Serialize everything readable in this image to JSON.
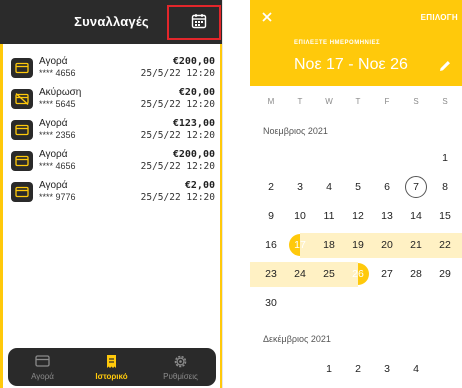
{
  "left": {
    "title": "Συναλλαγές",
    "transactions": [
      {
        "type": "Αγορά",
        "card": "**** 4656",
        "amount": "€200,00",
        "date": "25/5/22 12:20",
        "icon": "card-icon"
      },
      {
        "type": "Ακύρωση",
        "card": "**** 5645",
        "amount": "€20,00",
        "date": "25/5/22 12:20",
        "icon": "card-cancelled-icon"
      },
      {
        "type": "Αγορά",
        "card": "**** 2356",
        "amount": "€123,00",
        "date": "25/5/22 12:20",
        "icon": "card-icon"
      },
      {
        "type": "Αγορά",
        "card": "**** 4656",
        "amount": "€200,00",
        "date": "25/5/22 12:20",
        "icon": "card-icon"
      },
      {
        "type": "Αγορά",
        "card": "**** 9776",
        "amount": "€2,00",
        "date": "25/5/22 12:20",
        "icon": "card-icon"
      }
    ],
    "nav": [
      {
        "label": "Αγορά",
        "icon": "card-icon",
        "active": false
      },
      {
        "label": "Ιστορικό",
        "icon": "receipt-icon",
        "active": true
      },
      {
        "label": "Ρυθμίσεις",
        "icon": "gear-icon",
        "active": false
      }
    ],
    "colors": {
      "accent": "#ffc90b",
      "dark": "#2b2b2b",
      "highlight": "#e3262b"
    }
  },
  "right": {
    "close_icon": "close-icon",
    "select_label": "ΕΠΙΛΟΓΗ",
    "select_dates_label": "ΕΠΙΛΕΞΤΕ ΗΜΕΡΟΜΗΝΙΕΣ",
    "range_text": "Νοε 17 - Νοε 26",
    "edit_icon": "pencil-icon",
    "weekdays": [
      "M",
      "T",
      "W",
      "T",
      "F",
      "S",
      "S"
    ],
    "months": [
      {
        "label": "Νοεμβριος 2021",
        "first_weekday": 0,
        "days": 30,
        "today": 7,
        "range_start": 17,
        "range_end": 26
      },
      {
        "label": "Δεκέμβριος 2021",
        "first_weekday": 2,
        "days_shown": 4
      }
    ]
  }
}
